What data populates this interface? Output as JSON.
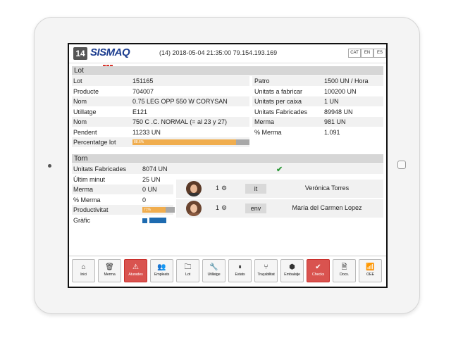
{
  "header": {
    "machine_id": "14",
    "logo": "SISMAQ",
    "info": "(14) 2018-05-04 21:35:00 79.154.193.169",
    "languages": [
      "CAT",
      "EN",
      "ES"
    ]
  },
  "lot": {
    "title": "Lot",
    "left": [
      {
        "label": "Lot",
        "value": "151165"
      },
      {
        "label": "Producte",
        "value": "704007"
      },
      {
        "label": "Nom",
        "value": "0.75 LEG OPP 550 W CORYSAN"
      },
      {
        "label": "Utillatge",
        "value": "E121"
      },
      {
        "label": "Nom",
        "value": "750 C .C. NORMAL (= al 23 y 27)"
      },
      {
        "label": "Pendent",
        "value": "11233 UN"
      },
      {
        "label": "Percentatge lot",
        "value": ""
      }
    ],
    "right": [
      {
        "label": "Patro",
        "value": "1500 UN / Hora"
      },
      {
        "label": "Unitats a fabricar",
        "value": "100200 UN"
      },
      {
        "label": "Unitats per caixa",
        "value": "1 UN"
      },
      {
        "label": "Unitats Fabricades",
        "value": "89948 UN"
      },
      {
        "label": "Merma",
        "value": "981 UN"
      },
      {
        "label": "% Merma",
        "value": "1.091"
      }
    ],
    "percent_value": 0.886,
    "percent_text": "88.6%"
  },
  "torn": {
    "title": "Torn",
    "rows": [
      {
        "label": "Unitats Fabricades",
        "value": "8074 UN"
      },
      {
        "label": "Últim minut",
        "value": "25 UN"
      },
      {
        "label": "Merma",
        "value": "0 UN"
      },
      {
        "label": "% Merma",
        "value": "0"
      },
      {
        "label": "Productivitat",
        "value": ""
      },
      {
        "label": "Gràfic",
        "value": ""
      }
    ],
    "productivity_value": 0.71,
    "productivity_text": "71%",
    "status_icon": "check-icon",
    "operators": [
      {
        "count": "1",
        "code": "it",
        "name": "Verónica Torres"
      },
      {
        "count": "1",
        "code": "env",
        "name": "María del Carmen Lopez"
      }
    ]
  },
  "toolbar": [
    {
      "icon": "⌂",
      "label": "Inici",
      "active": false
    },
    {
      "icon": "🗑",
      "label": "Merma",
      "active": false
    },
    {
      "icon": "⚠",
      "label": "Aturades",
      "active": true
    },
    {
      "icon": "👥",
      "label": "Empleats",
      "active": false
    },
    {
      "icon": "🗀",
      "label": "Lot",
      "active": false
    },
    {
      "icon": "🔧",
      "label": "Utillatge",
      "active": false
    },
    {
      "icon": "⏸",
      "label": "Estats",
      "active": false
    },
    {
      "icon": "⑂",
      "label": "Traçabilitat",
      "active": false
    },
    {
      "icon": "⬢",
      "label": "Embalatje",
      "active": false
    },
    {
      "icon": "✔",
      "label": "Checks",
      "active": true
    },
    {
      "icon": "🗎",
      "label": "Docs.",
      "active": false
    },
    {
      "icon": "📶",
      "label": "OEE",
      "active": false
    }
  ],
  "colors": {
    "accent": "#d9534f",
    "progress": "#f0ad4e",
    "brand": "#1c3d8f",
    "graph": "#1e6bb0"
  }
}
